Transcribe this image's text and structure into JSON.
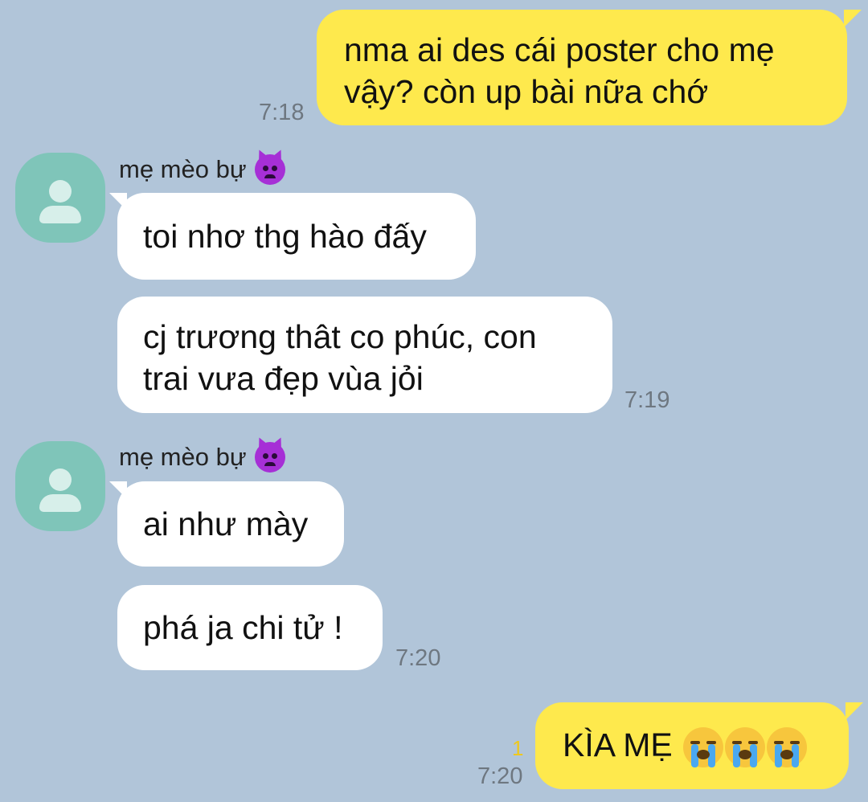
{
  "conversation": {
    "contact": {
      "name": "mẹ mèo bự",
      "name_emoji_icon": "angry-devil-icon"
    },
    "messages": [
      {
        "direction": "out",
        "text_line1": "nma ai des cái poster cho mẹ",
        "text_line2": "vậy? còn up bài nữa chớ",
        "time": "7:18"
      },
      {
        "direction": "in",
        "text": "toi nhơ thg hào đấy"
      },
      {
        "direction": "in",
        "text_line1": "cj trương thât co phúc, con",
        "text_line2": "trai vưa đẹp vùa jỏi",
        "time": "7:19"
      },
      {
        "direction": "in",
        "text": "ai như mày"
      },
      {
        "direction": "in",
        "text": "phá ja chi tử !",
        "time": "7:20"
      },
      {
        "direction": "out",
        "text": "KÌA MẸ",
        "emoji_icons": [
          "crying-face-icon",
          "crying-face-icon",
          "crying-face-icon"
        ],
        "time": "7:20",
        "unread_count": "1"
      }
    ]
  },
  "colors": {
    "background": "#b1c5d9",
    "outgoing_bubble": "#fee94d",
    "incoming_bubble": "#ffffff",
    "avatar": "#7fc5b9",
    "unread_count": "#efc81c"
  }
}
